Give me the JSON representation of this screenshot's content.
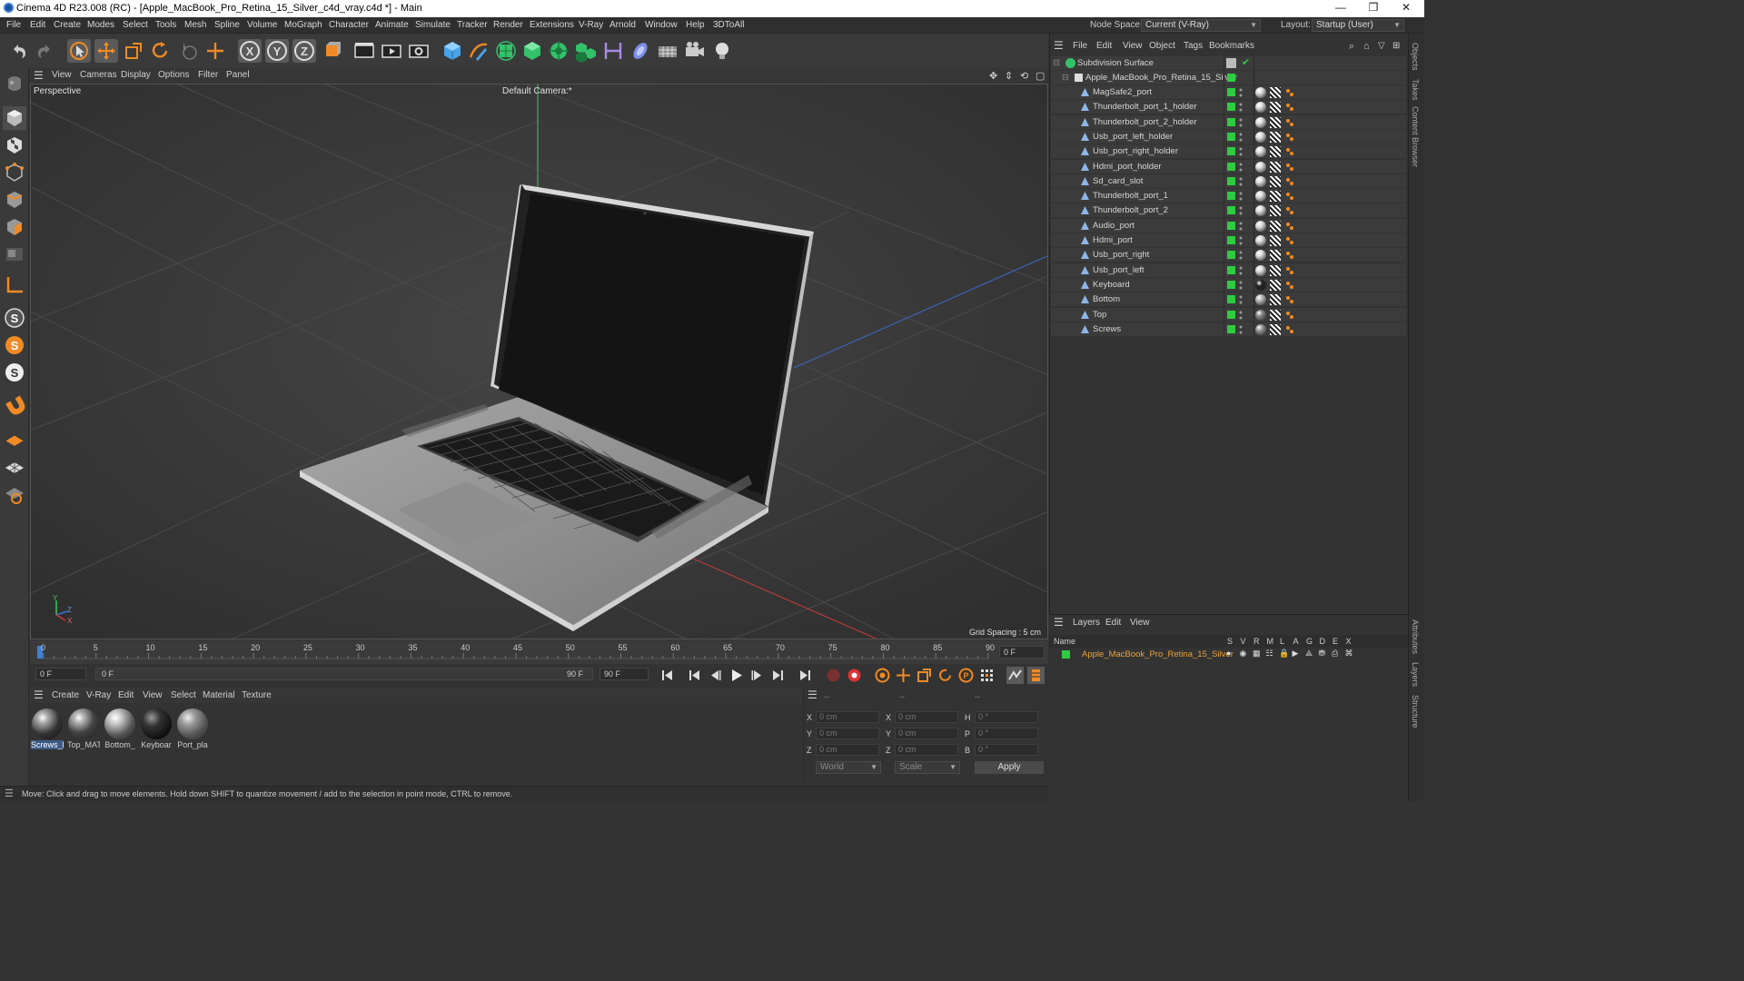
{
  "titlebar": {
    "title": "Cinema 4D R23.008 (RC) - [Apple_MacBook_Pro_Retina_15_Silver_c4d_vray.c4d *] - Main",
    "minimize": "—",
    "maximize": "❐",
    "close": "✕"
  },
  "menubar": {
    "items": [
      "File",
      "Edit",
      "Create",
      "Modes",
      "Select",
      "Tools",
      "Mesh",
      "Spline",
      "Volume",
      "MoGraph",
      "Character",
      "Animate",
      "Simulate",
      "Tracker",
      "Render",
      "Extensions",
      "V-Ray",
      "Arnold",
      "Window",
      "Help",
      "3DToAll"
    ],
    "node_space_label": "Node Space:",
    "node_space_value": "Current (V-Ray)",
    "layout_label": "Layout:",
    "layout_value": "Startup (User)"
  },
  "viewport": {
    "menu": [
      "View",
      "Cameras",
      "Display",
      "Options",
      "Filter",
      "Panel"
    ],
    "view_name": "Perspective",
    "camera": "Default Camera",
    "camera_suffix": ":*",
    "grid_spacing": "Grid Spacing : 5 cm",
    "axis_y": "Y",
    "axis_z": "Z",
    "axis_x": "X"
  },
  "timeline": {
    "ticks": [
      "0",
      "5",
      "10",
      "15",
      "20",
      "25",
      "30",
      "35",
      "40",
      "45",
      "50",
      "55",
      "60",
      "65",
      "70",
      "75",
      "80",
      "85",
      "90"
    ],
    "current_frame": "0 F",
    "start_field": "0 F",
    "range_start": "0 F",
    "range_end": "90 F",
    "end_field": "90 F"
  },
  "materials": {
    "menu": [
      "Create",
      "V-Ray",
      "Edit",
      "View",
      "Select",
      "Material",
      "Texture"
    ],
    "items": [
      {
        "name": "Screws_M",
        "selected": true
      },
      {
        "name": "Top_MAT",
        "selected": false
      },
      {
        "name": "Bottom_",
        "selected": false
      },
      {
        "name": "Keyboar",
        "selected": false
      },
      {
        "name": "Port_pla",
        "selected": false
      }
    ]
  },
  "coords": {
    "header": [
      "--",
      "--",
      "--"
    ],
    "rows": [
      {
        "axis": "X",
        "pos": "0 cm",
        "axis2": "X",
        "size": "0 cm",
        "axis3": "H",
        "rot": "0 °"
      },
      {
        "axis": "Y",
        "pos": "0 cm",
        "axis2": "Y",
        "size": "0 cm",
        "axis3": "P",
        "rot": "0 °"
      },
      {
        "axis": "Z",
        "pos": "0 cm",
        "axis2": "Z",
        "size": "0 cm",
        "axis3": "B",
        "rot": "0 °"
      }
    ],
    "mode1": "World",
    "mode2": "Scale",
    "apply": "Apply"
  },
  "status": {
    "text": "Move: Click and drag to move elements. Hold down SHIFT to quantize movement / add to the selection in point mode, CTRL to remove."
  },
  "objects": {
    "menu": [
      "File",
      "Edit",
      "View",
      "Object",
      "Tags",
      "Bookmarks"
    ],
    "root": "Subdivision Surface",
    "group": "Apple_MacBook_Pro_Retina_15_Silver",
    "children": [
      "MagSafe2_port",
      "Thunderbolt_port_1_holder",
      "Thunderbolt_port_2_holder",
      "Usb_port_left_holder",
      "Usb_port_right_holder",
      "Hdmi_port_holder",
      "Sd_card_slot",
      "Thunderbolt_port_1",
      "Thunderbolt_port_2",
      "Audio_port",
      "Hdmi_port",
      "Usb_port_right",
      "Usb_port_left",
      "Keyboard",
      "Bottom",
      "Top",
      "Screws"
    ]
  },
  "layers": {
    "menu": [
      "Layers",
      "Edit",
      "View"
    ],
    "name_header": "Name",
    "col_headers": [
      "S",
      "V",
      "R",
      "M",
      "L",
      "A",
      "G",
      "D",
      "E",
      "X"
    ],
    "items": [
      {
        "name": "Apple_MacBook_Pro_Retina_15_Silver",
        "color": "#2ecc40"
      }
    ]
  },
  "side_tabs": [
    "Objects",
    "Takes",
    "Content Browser",
    "Attributes",
    "Layers",
    "Structure"
  ],
  "colors": {
    "accent_orange": "#f08a24",
    "layer_name": "#e8a33a",
    "check_green": "#2ecc40",
    "axis_red": "#c83b3b",
    "axis_blue": "#3b6ac8",
    "axis_green": "#3bc860"
  }
}
